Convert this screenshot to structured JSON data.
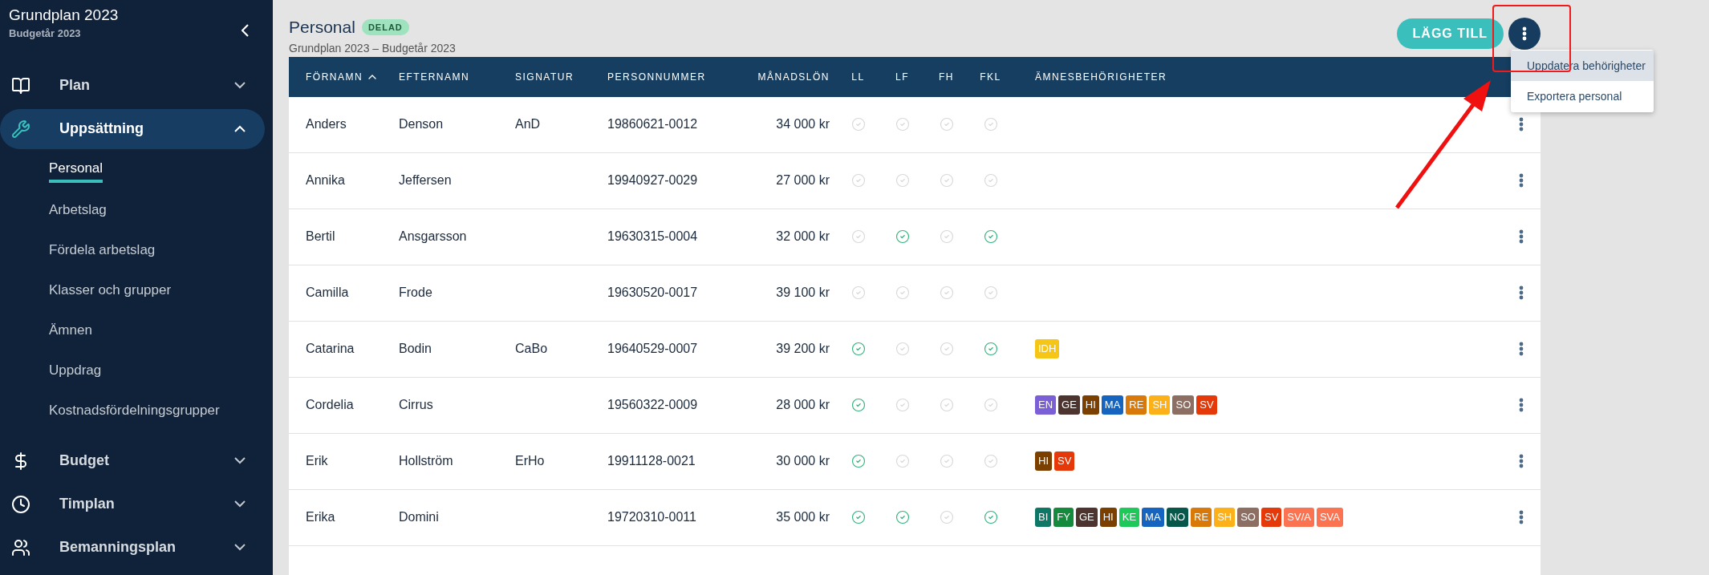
{
  "sidebar": {
    "title": "Grundplan 2023",
    "subtitle": "Budgetår 2023",
    "items": [
      {
        "label": "Plan",
        "kind": "book",
        "expanded": false,
        "selected": false
      },
      {
        "label": "Uppsättning",
        "kind": "wrench",
        "expanded": true,
        "selected": true,
        "children": [
          {
            "label": "Personal",
            "selected": true
          },
          {
            "label": "Arbetslag",
            "selected": false
          },
          {
            "label": "Fördela arbetslag",
            "selected": false
          },
          {
            "label": "Klasser och grupper",
            "selected": false
          },
          {
            "label": "Ämnen",
            "selected": false
          },
          {
            "label": "Uppdrag",
            "selected": false
          },
          {
            "label": "Kostnadsfördelningsgrupper",
            "selected": false
          }
        ]
      },
      {
        "label": "Budget",
        "kind": "dollar",
        "expanded": false,
        "selected": false
      },
      {
        "label": "Timplan",
        "kind": "clock",
        "expanded": false,
        "selected": false
      },
      {
        "label": "Bemanningsplan",
        "kind": "people",
        "expanded": false,
        "selected": false
      }
    ]
  },
  "header": {
    "title": "Personal",
    "badge": "DELAD",
    "subtitle": "Grundplan 2023 – Budgetår 2023",
    "add_button": "LÄGG TILL"
  },
  "menu": {
    "items": [
      {
        "label": "Uppdatera behörigheter",
        "selected": true
      },
      {
        "label": "Exportera personal",
        "selected": false
      }
    ]
  },
  "table": {
    "columns": [
      "FÖRNAMN",
      "EFTERNAMN",
      "SIGNATUR",
      "PERSONNUMMER",
      "MÅNADSLÖN",
      "LL",
      "LF",
      "FH",
      "FKL",
      "ÄMNESBEHÖRIGHETER"
    ],
    "rows": [
      {
        "first": "Anders",
        "last": "Denson",
        "signature": "AnD",
        "pnr": "19860621-0012",
        "salary": "34 000 kr",
        "ll": false,
        "lf": false,
        "fh": false,
        "fkl": false,
        "subjects": []
      },
      {
        "first": "Annika",
        "last": "Jeffersen",
        "signature": "",
        "pnr": "19940927-0029",
        "salary": "27 000 kr",
        "ll": false,
        "lf": false,
        "fh": false,
        "fkl": false,
        "subjects": []
      },
      {
        "first": "Bertil",
        "last": "Ansgarsson",
        "signature": "",
        "pnr": "19630315-0004",
        "salary": "32 000 kr",
        "ll": false,
        "lf": true,
        "fh": false,
        "fkl": true,
        "subjects": []
      },
      {
        "first": "Camilla",
        "last": "Frode",
        "signature": "",
        "pnr": "19630520-0017",
        "salary": "39 100 kr",
        "ll": false,
        "lf": false,
        "fh": false,
        "fkl": false,
        "subjects": []
      },
      {
        "first": "Catarina",
        "last": "Bodin",
        "signature": "CaBo",
        "pnr": "19640529-0007",
        "salary": "39 200 kr",
        "ll": true,
        "lf": false,
        "fh": false,
        "fkl": true,
        "subjects": [
          {
            "label": "IDH",
            "color": "#f5c518"
          }
        ]
      },
      {
        "first": "Cordelia",
        "last": "Cirrus",
        "signature": "",
        "pnr": "19560322-0009",
        "salary": "28 000 kr",
        "ll": true,
        "lf": false,
        "fh": false,
        "fkl": false,
        "subjects": [
          {
            "label": "EN",
            "color": "#7b5fd6"
          },
          {
            "label": "GE",
            "color": "#4e342e"
          },
          {
            "label": "HI",
            "color": "#7b3f00"
          },
          {
            "label": "MA",
            "color": "#1565c0"
          },
          {
            "label": "RE",
            "color": "#d9790a"
          },
          {
            "label": "SH",
            "color": "#fbb117"
          },
          {
            "label": "SO",
            "color": "#8d6e63"
          },
          {
            "label": "SV",
            "color": "#e53909"
          }
        ]
      },
      {
        "first": "Erik",
        "last": "Hollström",
        "signature": "ErHo",
        "pnr": "19911128-0021",
        "salary": "30 000 kr",
        "ll": true,
        "lf": false,
        "fh": false,
        "fkl": false,
        "subjects": [
          {
            "label": "HI",
            "color": "#7b3f00"
          },
          {
            "label": "SV",
            "color": "#e53909"
          }
        ]
      },
      {
        "first": "Erika",
        "last": "Domini",
        "signature": "",
        "pnr": "19720310-0011",
        "salary": "35 000 kr",
        "ll": true,
        "lf": true,
        "fh": false,
        "fkl": true,
        "subjects": [
          {
            "label": "BI",
            "color": "#0f7765"
          },
          {
            "label": "FY",
            "color": "#138a3c"
          },
          {
            "label": "GE",
            "color": "#4e342e"
          },
          {
            "label": "HI",
            "color": "#7b3f00"
          },
          {
            "label": "KE",
            "color": "#1ec95a"
          },
          {
            "label": "MA",
            "color": "#1565c0"
          },
          {
            "label": "NO",
            "color": "#05584a"
          },
          {
            "label": "RE",
            "color": "#d9790a"
          },
          {
            "label": "SH",
            "color": "#fbb117"
          },
          {
            "label": "SO",
            "color": "#8d6e63"
          },
          {
            "label": "SV",
            "color": "#e53909"
          },
          {
            "label": "SV/A",
            "color": "#fb7350"
          },
          {
            "label": "SVA",
            "color": "#fb7350"
          }
        ]
      }
    ]
  }
}
